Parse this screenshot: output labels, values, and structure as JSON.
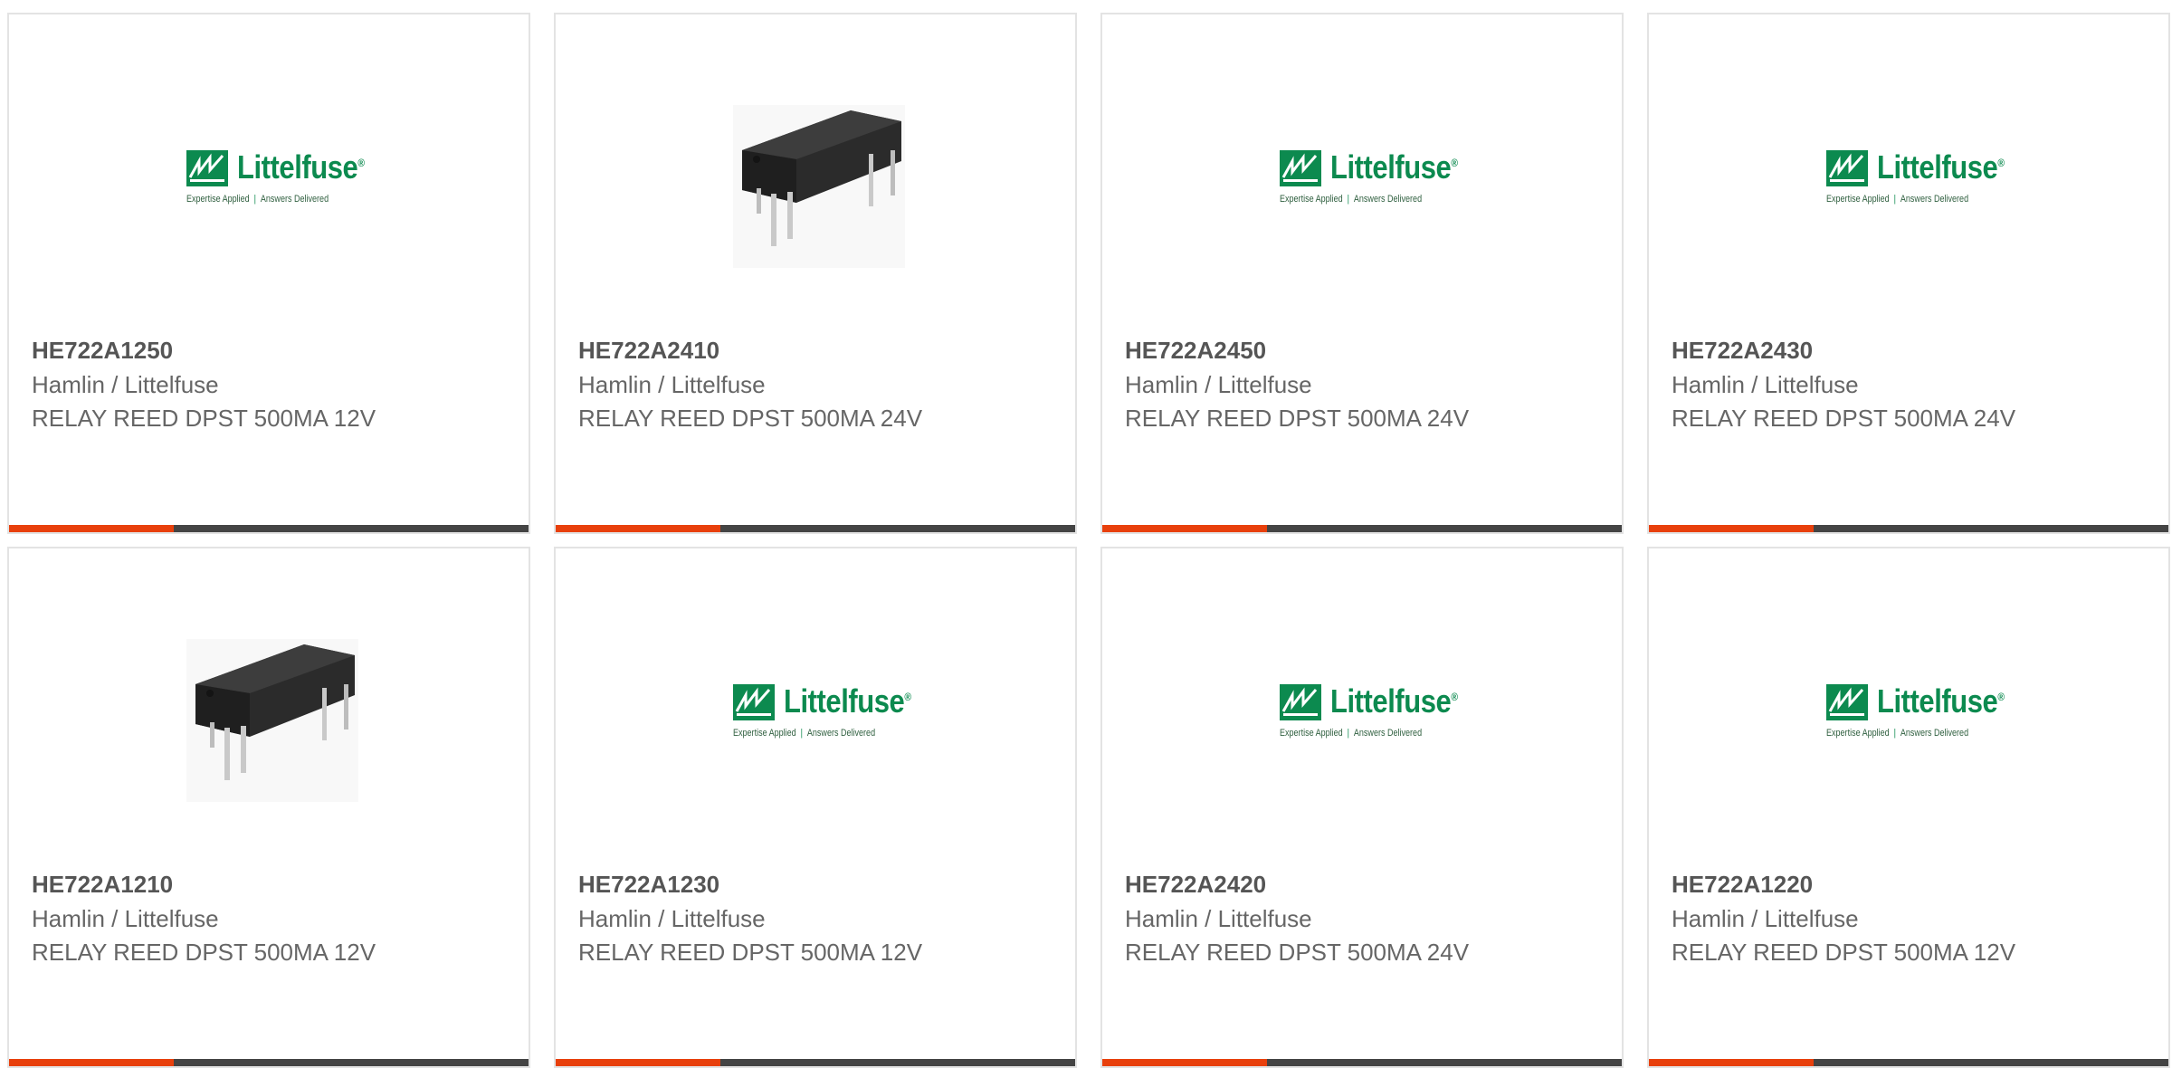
{
  "colors": {
    "accent": "#e8400c",
    "bar_dark": "#444444",
    "brand_green": "#0c8a4f"
  },
  "logo": {
    "word": "Littelfuse",
    "reg": "®",
    "tag_left": "Expertise Applied",
    "tag_right": "Answers Delivered"
  },
  "products": [
    {
      "part": "HE722A1250",
      "manufacturer": "Hamlin / Littelfuse",
      "description": "RELAY REED DPST 500MA 12V",
      "image": "logo"
    },
    {
      "part": "HE722A2410",
      "manufacturer": "Hamlin / Littelfuse",
      "description": "RELAY REED DPST 500MA 24V",
      "image": "relay-photo"
    },
    {
      "part": "HE722A2450",
      "manufacturer": "Hamlin / Littelfuse",
      "description": "RELAY REED DPST 500MA 24V",
      "image": "logo"
    },
    {
      "part": "HE722A2430",
      "manufacturer": "Hamlin / Littelfuse",
      "description": "RELAY REED DPST 500MA 24V",
      "image": "logo"
    },
    {
      "part": "HE722A1210",
      "manufacturer": "Hamlin / Littelfuse",
      "description": "RELAY REED DPST 500MA 12V",
      "image": "relay-photo"
    },
    {
      "part": "HE722A1230",
      "manufacturer": "Hamlin / Littelfuse",
      "description": "RELAY REED DPST 500MA 12V",
      "image": "logo"
    },
    {
      "part": "HE722A2420",
      "manufacturer": "Hamlin / Littelfuse",
      "description": "RELAY REED DPST 500MA 24V",
      "image": "logo"
    },
    {
      "part": "HE722A1220",
      "manufacturer": "Hamlin / Littelfuse",
      "description": "RELAY REED DPST 500MA 12V",
      "image": "logo"
    }
  ]
}
